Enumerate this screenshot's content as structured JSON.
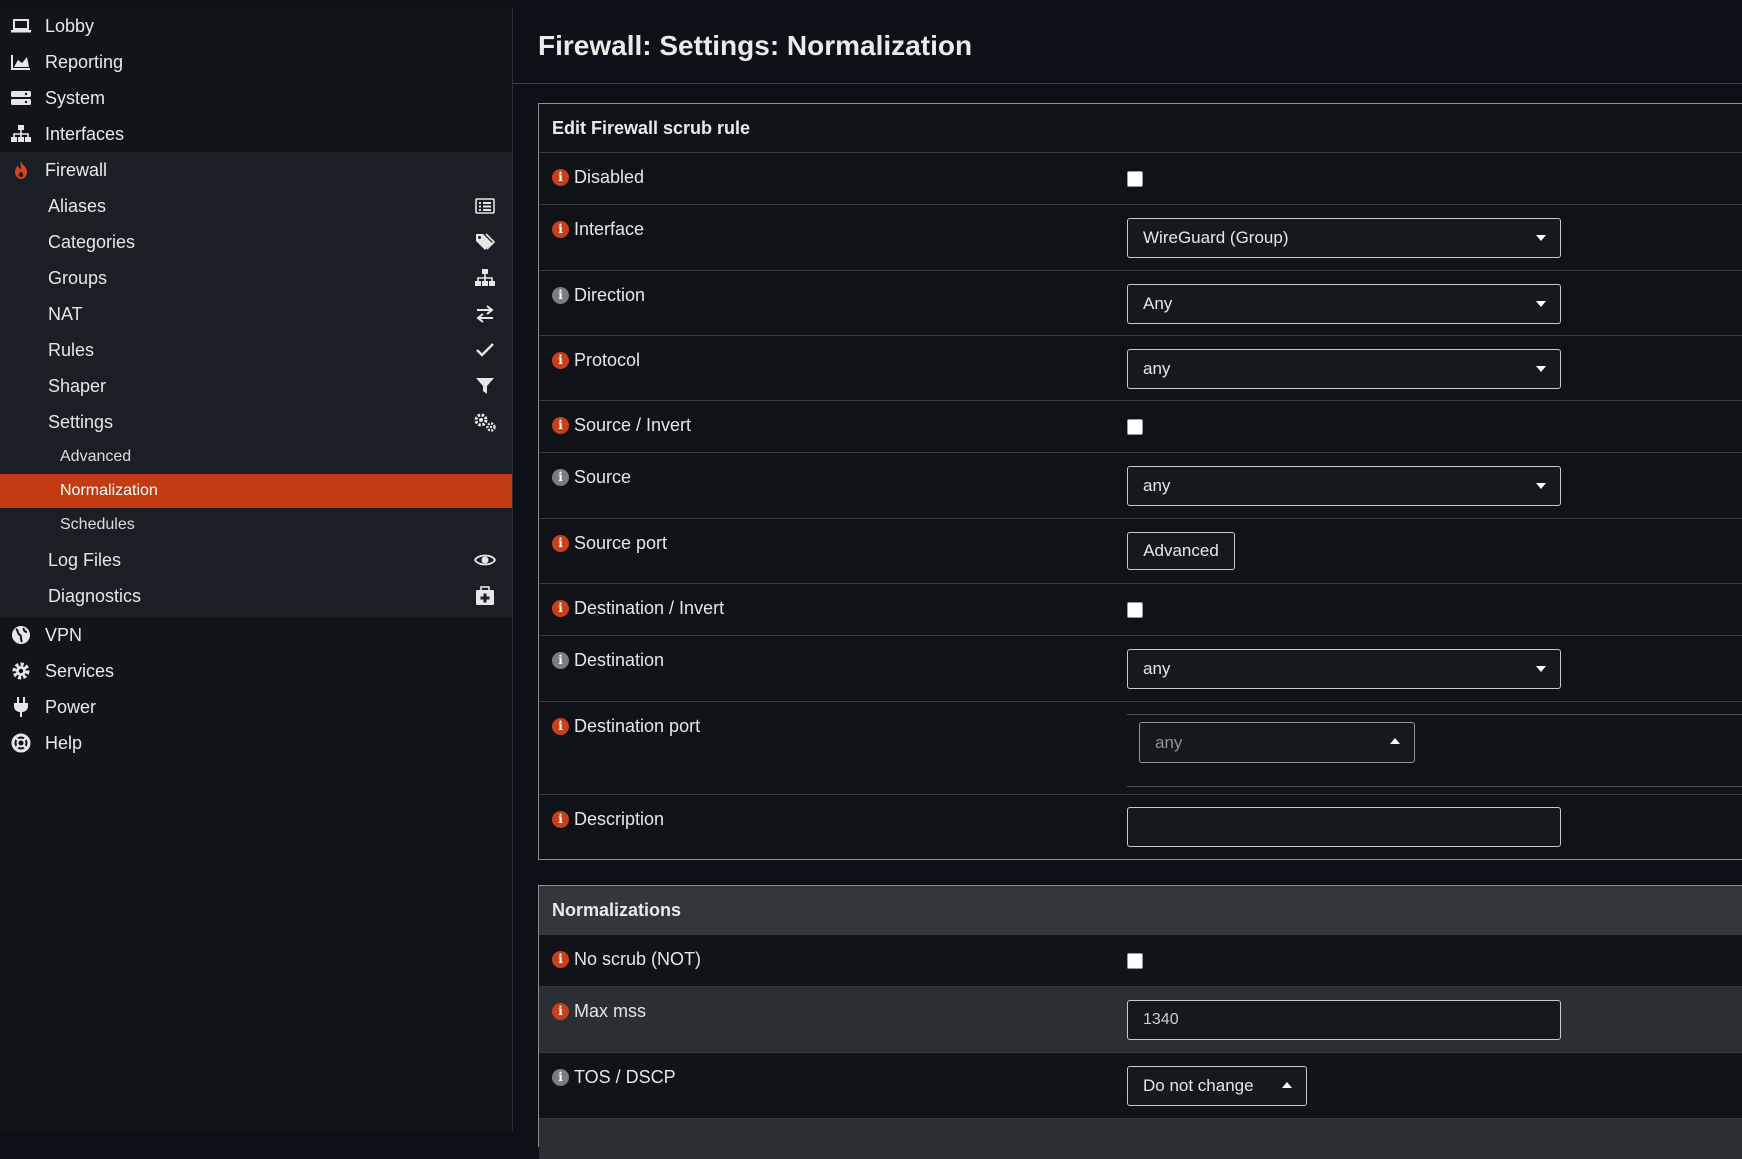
{
  "sidebar": {
    "top_items": [
      {
        "label": "Lobby",
        "icon": "laptop-icon"
      },
      {
        "label": "Reporting",
        "icon": "area-chart-icon"
      },
      {
        "label": "System",
        "icon": "server-icon"
      },
      {
        "label": "Interfaces",
        "icon": "sitemap-icon"
      },
      {
        "label": "Firewall",
        "icon": "fire-icon"
      }
    ],
    "firewall_items": [
      {
        "label": "Aliases",
        "icon": "list-alt-icon"
      },
      {
        "label": "Categories",
        "icon": "tags-icon"
      },
      {
        "label": "Groups",
        "icon": "sitemap-icon"
      },
      {
        "label": "NAT",
        "icon": "exchange-icon"
      },
      {
        "label": "Rules",
        "icon": "check-icon"
      },
      {
        "label": "Shaper",
        "icon": "filter-icon"
      },
      {
        "label": "Settings",
        "icon": "cogs-icon"
      }
    ],
    "settings_items": [
      {
        "label": "Advanced"
      },
      {
        "label": "Normalization",
        "active": true
      },
      {
        "label": "Schedules"
      }
    ],
    "firewall_items_after": [
      {
        "label": "Log Files",
        "icon": "eye-icon"
      },
      {
        "label": "Diagnostics",
        "icon": "medkit-icon"
      }
    ],
    "bottom_items": [
      {
        "label": "VPN",
        "icon": "globe-icon"
      },
      {
        "label": "Services",
        "icon": "gear-icon"
      },
      {
        "label": "Power",
        "icon": "plug-icon"
      },
      {
        "label": "Help",
        "icon": "life-ring-icon"
      }
    ]
  },
  "main": {
    "title": "Firewall: Settings: Normalization",
    "edit_panel": {
      "heading": "Edit Firewall scrub rule",
      "disabled_label": "Disabled",
      "interface_label": "Interface",
      "interface_value": "WireGuard (Group)",
      "direction_label": "Direction",
      "direction_value": "Any",
      "protocol_label": "Protocol",
      "protocol_value": "any",
      "source_invert_label": "Source / Invert",
      "source_label": "Source",
      "source_value": "any",
      "source_port_label": "Source port",
      "source_port_button": "Advanced",
      "dest_invert_label": "Destination / Invert",
      "destination_label": "Destination",
      "destination_value": "any",
      "dest_port_label": "Destination port",
      "dest_port_value": "any",
      "description_label": "Description",
      "description_value": ""
    },
    "norm_panel": {
      "heading": "Normalizations",
      "noscrub_label": "No scrub (NOT)",
      "maxmss_label": "Max mss",
      "maxmss_value": "1340",
      "tos_label": "TOS / DSCP",
      "tos_value": "Do not change"
    },
    "info_icon_glyph": "i"
  },
  "colors": {
    "accent": "#c23b12",
    "info_icon": "#c8401a",
    "info_icon_grey": "#7a7d80"
  }
}
